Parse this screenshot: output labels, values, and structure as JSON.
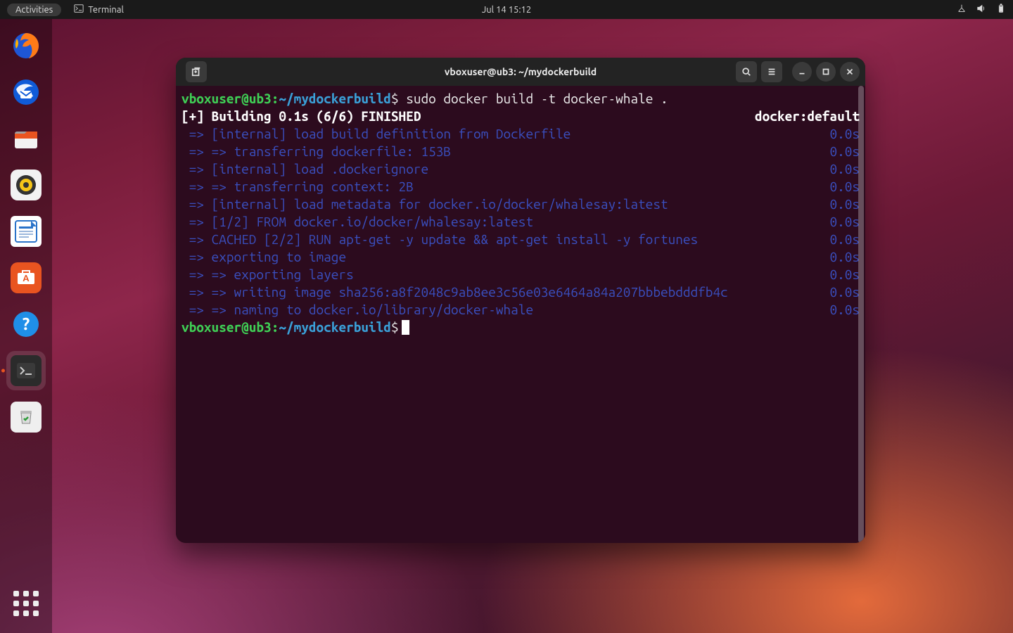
{
  "topbar": {
    "activities": "Activities",
    "app_label": "Terminal",
    "datetime": "Jul 14  15:12"
  },
  "dock": {
    "items": [
      {
        "name": "firefox"
      },
      {
        "name": "thunderbird"
      },
      {
        "name": "files"
      },
      {
        "name": "rhythmbox"
      },
      {
        "name": "libreoffice-writer"
      },
      {
        "name": "ubuntu-software"
      },
      {
        "name": "help"
      },
      {
        "name": "terminal",
        "active": true
      },
      {
        "name": "trash"
      }
    ]
  },
  "terminal": {
    "title": "vboxuser@ub3: ~/mydockerbuild",
    "prompt": {
      "user": "vboxuser@ub3",
      "path": "~/mydockerbuild",
      "dollar": "$"
    },
    "command": "sudo docker build -t docker-whale .",
    "summary_left": "[+] Building 0.1s (6/6) FINISHED",
    "summary_right": "docker:default",
    "steps": [
      {
        "text": " => [internal] load build definition from Dockerfile",
        "time": "0.0s"
      },
      {
        "text": " => => transferring dockerfile: 153B",
        "time": "0.0s"
      },
      {
        "text": " => [internal] load .dockerignore",
        "time": "0.0s"
      },
      {
        "text": " => => transferring context: 2B",
        "time": "0.0s"
      },
      {
        "text": " => [internal] load metadata for docker.io/docker/whalesay:latest",
        "time": "0.0s"
      },
      {
        "text": " => [1/2] FROM docker.io/docker/whalesay:latest",
        "time": "0.0s"
      },
      {
        "text": " => CACHED [2/2] RUN apt-get -y update && apt-get install -y fortunes",
        "time": "0.0s"
      },
      {
        "text": " => exporting to image",
        "time": "0.0s"
      },
      {
        "text": " => => exporting layers",
        "time": "0.0s"
      },
      {
        "text": " => => writing image sha256:a8f2048c9ab8ee3c56e03e6464a84a207bbbebdddfb4c",
        "time": "0.0s"
      },
      {
        "text": " => => naming to docker.io/library/docker-whale",
        "time": "0.0s"
      }
    ]
  }
}
